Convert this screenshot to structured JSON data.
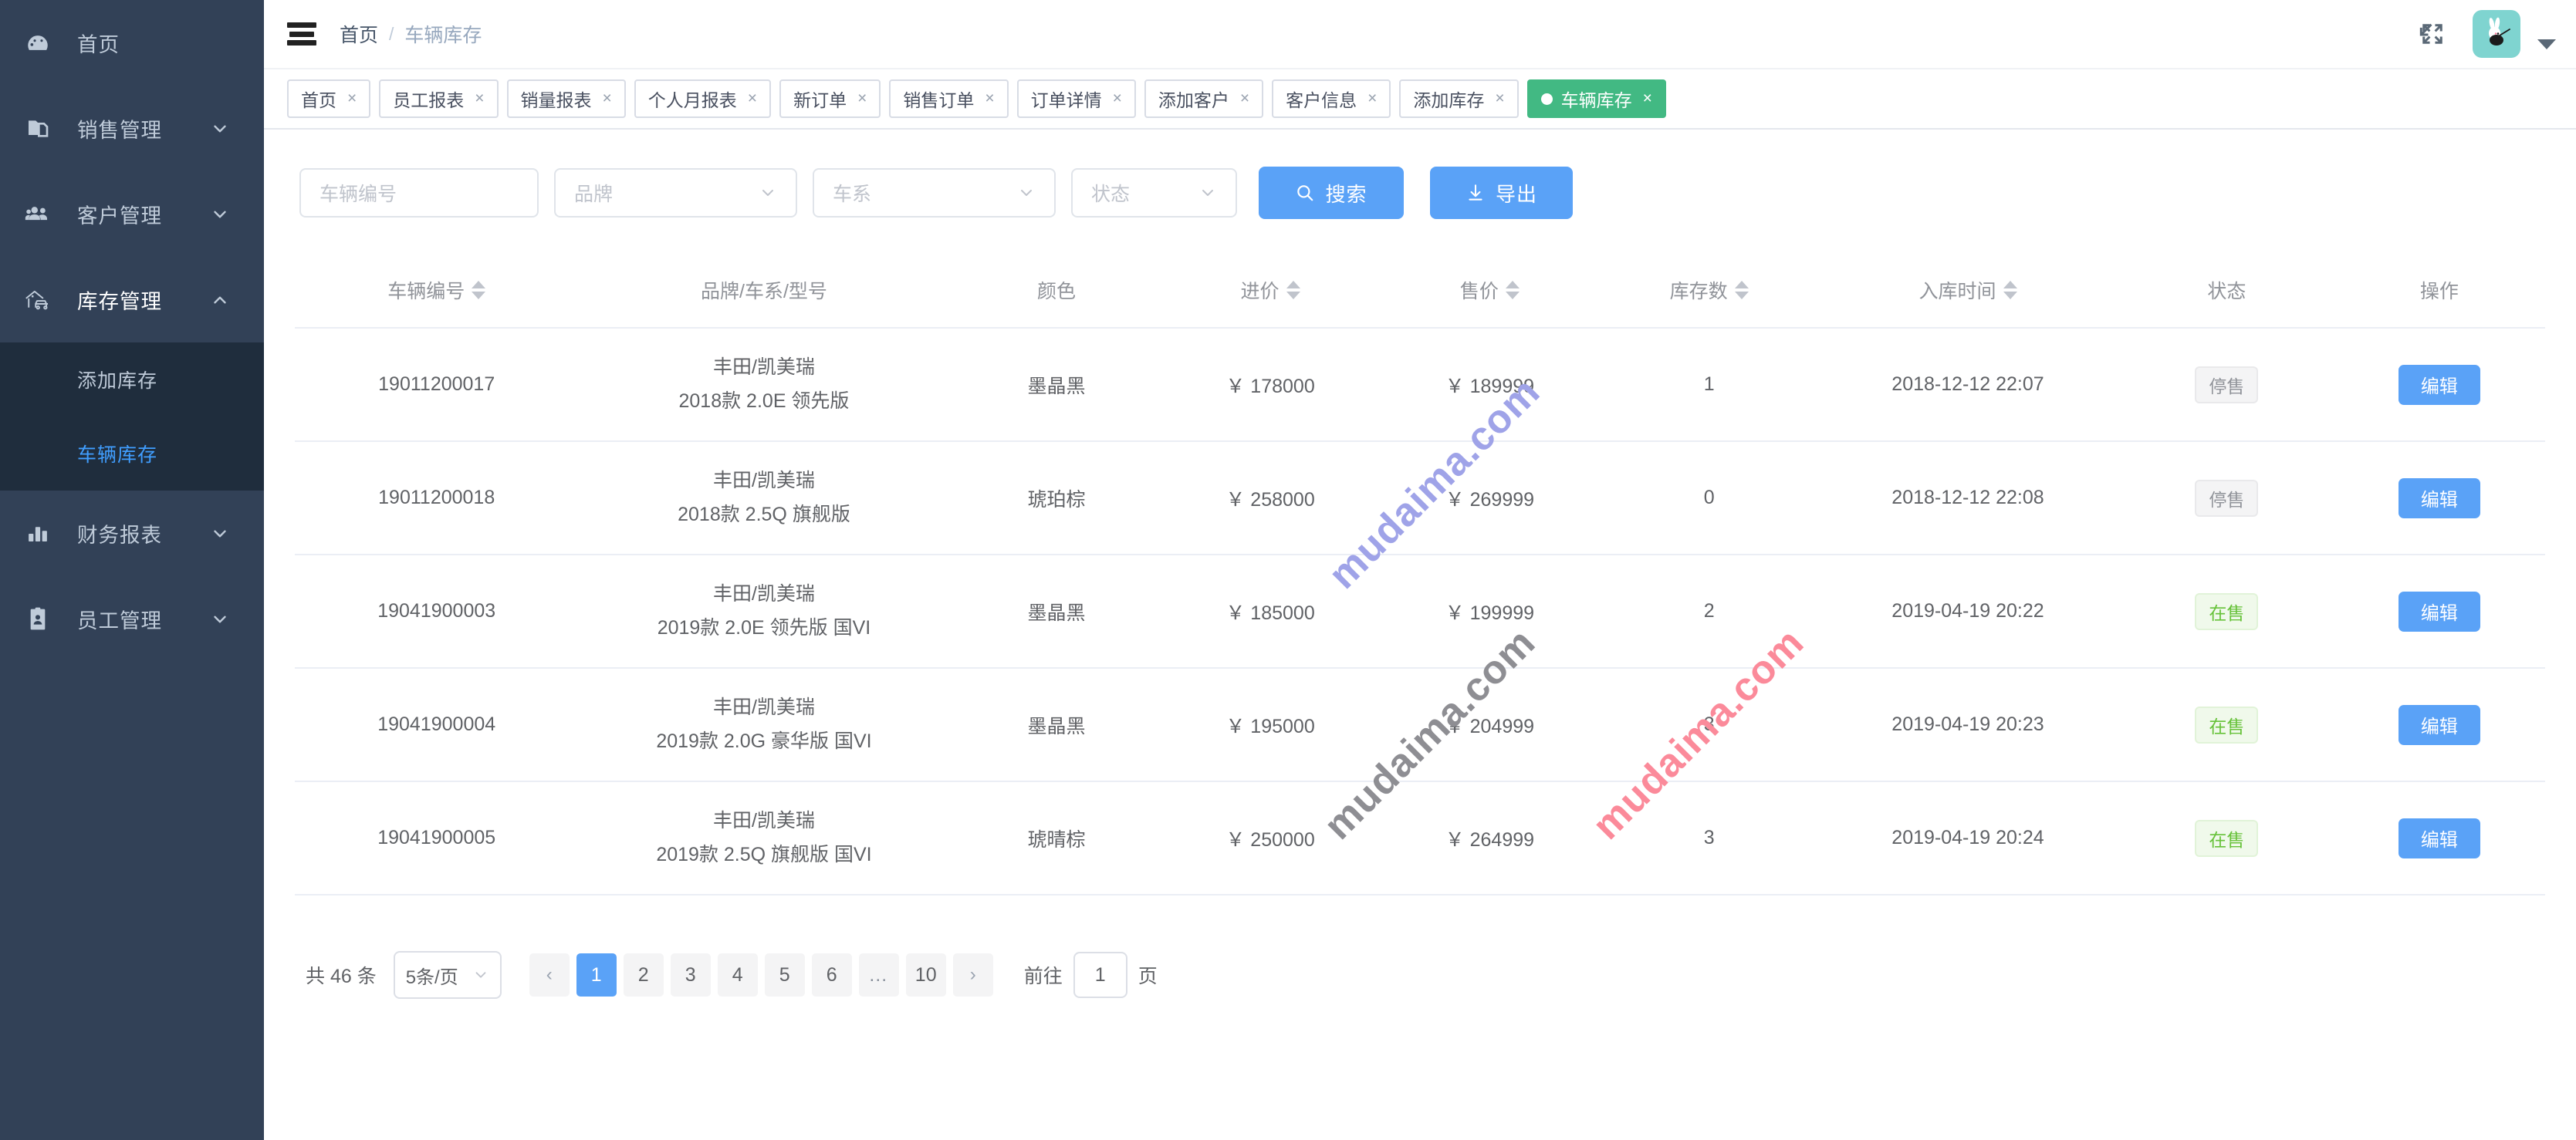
{
  "sidebar": {
    "items": [
      {
        "label": "首页",
        "icon": "dashboard-icon",
        "expandable": false,
        "state": ""
      },
      {
        "label": "销售管理",
        "icon": "sales-doc-icon",
        "expandable": true,
        "state": "collapsed"
      },
      {
        "label": "客户管理",
        "icon": "users-icon",
        "expandable": true,
        "state": "collapsed"
      },
      {
        "label": "库存管理",
        "icon": "garage-car-icon",
        "expandable": true,
        "state": "expanded"
      },
      {
        "label": "财务报表",
        "icon": "bar-chart-icon",
        "expandable": true,
        "state": "collapsed"
      },
      {
        "label": "员工管理",
        "icon": "id-badge-icon",
        "expandable": true,
        "state": "collapsed"
      }
    ],
    "submenu": [
      {
        "label": "添加库存",
        "active": false
      },
      {
        "label": "车辆库存",
        "active": true
      }
    ]
  },
  "header": {
    "menu_icon": "hamburger-icon",
    "breadcrumb": {
      "home": "首页",
      "separator": "/",
      "current": "车辆库存"
    },
    "fullscreen_icon": "fullscreen-icon",
    "avatar_icon": "rabbit-avatar",
    "avatar_bg": "#7fd4d0",
    "dropdown_icon": "caret-down-icon"
  },
  "tabs": [
    {
      "label": "首页",
      "active": false
    },
    {
      "label": "员工报表",
      "active": false
    },
    {
      "label": "销量报表",
      "active": false
    },
    {
      "label": "个人月报表",
      "active": false
    },
    {
      "label": "新订单",
      "active": false
    },
    {
      "label": "销售订单",
      "active": false
    },
    {
      "label": "订单详情",
      "active": false
    },
    {
      "label": "添加客户",
      "active": false
    },
    {
      "label": "客户信息",
      "active": false
    },
    {
      "label": "添加库存",
      "active": false
    },
    {
      "label": "车辆库存",
      "active": true
    }
  ],
  "tab_close_glyph": "×",
  "active_tab_color": "#42b983",
  "filters": {
    "vehicle_no": {
      "value": "",
      "placeholder": "车辆编号"
    },
    "brand": {
      "value": "",
      "placeholder": "品牌"
    },
    "series": {
      "value": "",
      "placeholder": "车系"
    },
    "status": {
      "value": "",
      "placeholder": "状态"
    },
    "search_button": "搜索",
    "search_icon": "search-icon",
    "export_button": "导出",
    "export_icon": "download-icon",
    "button_color": "#5aa2f7"
  },
  "table": {
    "columns": [
      {
        "label": "车辆编号",
        "sortable": true
      },
      {
        "label": "品牌/车系/型号",
        "sortable": false
      },
      {
        "label": "颜色",
        "sortable": false
      },
      {
        "label": "进价",
        "sortable": true
      },
      {
        "label": "售价",
        "sortable": true
      },
      {
        "label": "库存数",
        "sortable": true
      },
      {
        "label": "入库时间",
        "sortable": true
      },
      {
        "label": "状态",
        "sortable": false
      },
      {
        "label": "操作",
        "sortable": false
      }
    ],
    "rows": [
      {
        "vehicle_no": "19011200017",
        "brand_series": "丰田/凯美瑞",
        "model": "2018款 2.0E 领先版",
        "color": "墨晶黑",
        "cost_price": "￥ 178000",
        "sale_price": "￥ 189999",
        "stock": "1",
        "intake_time": "2018-12-12 22:07",
        "status": "停售",
        "status_kind": "off",
        "action": "编辑"
      },
      {
        "vehicle_no": "19011200018",
        "brand_series": "丰田/凯美瑞",
        "model": "2018款 2.5Q 旗舰版",
        "color": "琥珀棕",
        "cost_price": "￥ 258000",
        "sale_price": "￥ 269999",
        "stock": "0",
        "intake_time": "2018-12-12 22:08",
        "status": "停售",
        "status_kind": "off",
        "action": "编辑"
      },
      {
        "vehicle_no": "19041900003",
        "brand_series": "丰田/凯美瑞",
        "model": "2019款 2.0E 领先版 国VI",
        "color": "墨晶黑",
        "cost_price": "￥ 185000",
        "sale_price": "￥ 199999",
        "stock": "2",
        "intake_time": "2019-04-19 20:22",
        "status": "在售",
        "status_kind": "on",
        "action": "编辑"
      },
      {
        "vehicle_no": "19041900004",
        "brand_series": "丰田/凯美瑞",
        "model": "2019款 2.0G 豪华版 国VI",
        "color": "墨晶黑",
        "cost_price": "￥ 195000",
        "sale_price": "￥ 204999",
        "stock": "3",
        "intake_time": "2019-04-19 20:23",
        "status": "在售",
        "status_kind": "on",
        "action": "编辑"
      },
      {
        "vehicle_no": "19041900005",
        "brand_series": "丰田/凯美瑞",
        "model": "2019款 2.5Q 旗舰版 国VI",
        "color": "琥晴棕",
        "cost_price": "￥ 250000",
        "sale_price": "￥ 264999",
        "stock": "3",
        "intake_time": "2019-04-19 20:24",
        "status": "在售",
        "status_kind": "on",
        "action": "编辑"
      }
    ]
  },
  "pagination": {
    "total_text": "共 46 条",
    "page_size": "5条/页",
    "prev_glyph": "‹",
    "next_glyph": "›",
    "pages": [
      "1",
      "2",
      "3",
      "4",
      "5",
      "6",
      "…",
      "10"
    ],
    "current_page": "1",
    "jump_prefix": "前往",
    "jump_value": "1",
    "jump_suffix": "页"
  },
  "watermarks": [
    {
      "text": "mudaima.com",
      "color": "#9fa3e8"
    },
    {
      "text": "mudaima.com",
      "color": "#8e8e93"
    },
    {
      "text": "mudaima.com",
      "color": "#fb8a9a"
    }
  ]
}
